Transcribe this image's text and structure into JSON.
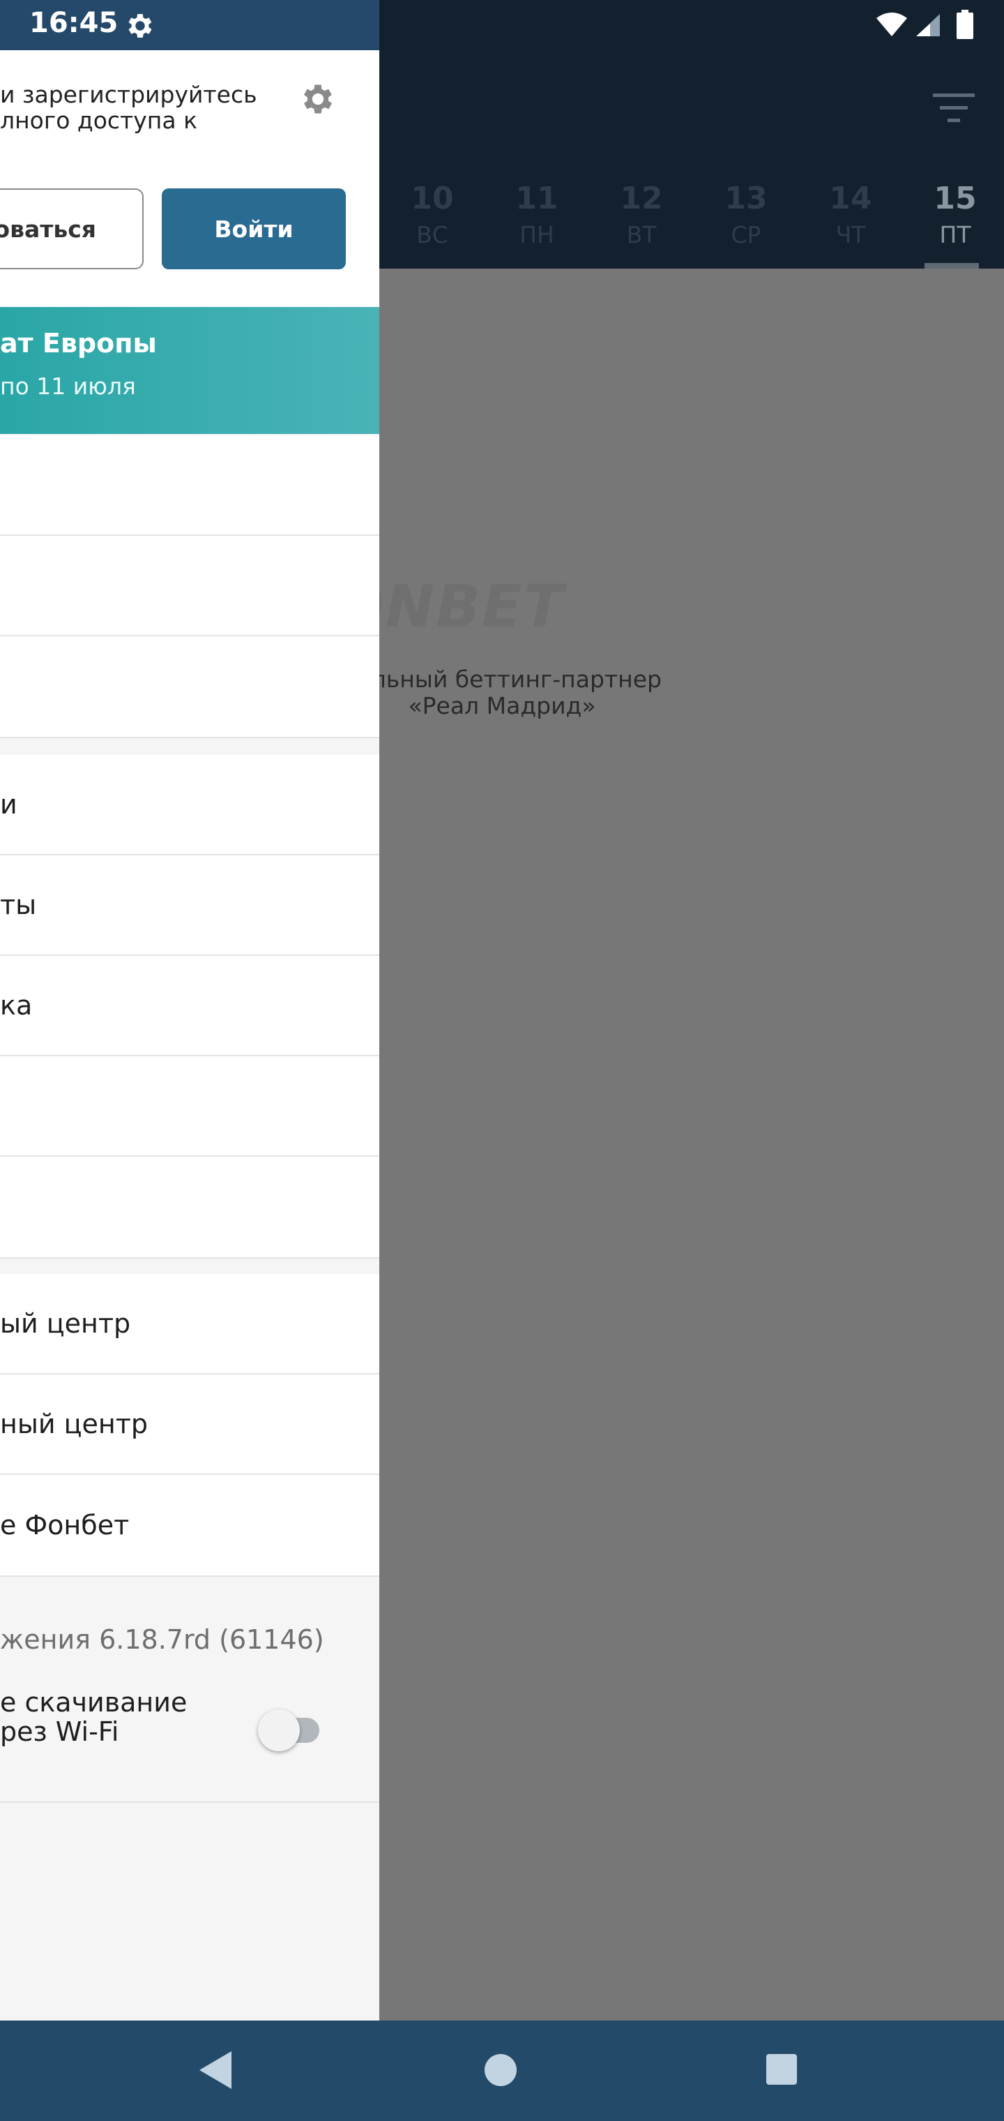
{
  "status_bar": {
    "time": "16:45"
  },
  "background": {
    "days": [
      {
        "num": "10",
        "dow": "ВС"
      },
      {
        "num": "11",
        "dow": "ПН"
      },
      {
        "num": "12",
        "dow": "ВТ"
      },
      {
        "num": "13",
        "dow": "СР"
      },
      {
        "num": "14",
        "dow": "ЧТ"
      },
      {
        "num": "15",
        "dow": "ПТ"
      }
    ],
    "logo_text": "FONBET",
    "partner_line1": "иальный беттинг-партнер",
    "partner_line2": "«Реал Мадрид»"
  },
  "drawer": {
    "login_prompt_line1": "и зарегистрируйтесь",
    "login_prompt_line2": "лного доступа к",
    "register_label": "оваться",
    "login_label": "Войти",
    "promo_title": "ат Европы",
    "promo_subtitle": "по 11 июля",
    "group1": [
      "",
      "",
      ""
    ],
    "group2": [
      "и",
      "ты",
      "ка",
      "",
      ""
    ],
    "group3": [
      "ый центр",
      "ный центр",
      "е Фонбет"
    ],
    "version": "жения 6.18.7rd (61146)",
    "autodownload_line1": "е скачивание",
    "autodownload_line2": "рез Wi-Fi",
    "autodownload_enabled": false
  },
  "colors": {
    "header_bg": "#13212f",
    "status_bg": "#24496a",
    "accent": "#2a6b92",
    "promo": "#2aa6a6",
    "nav_bg": "#234b69",
    "scrim": "#777777"
  }
}
